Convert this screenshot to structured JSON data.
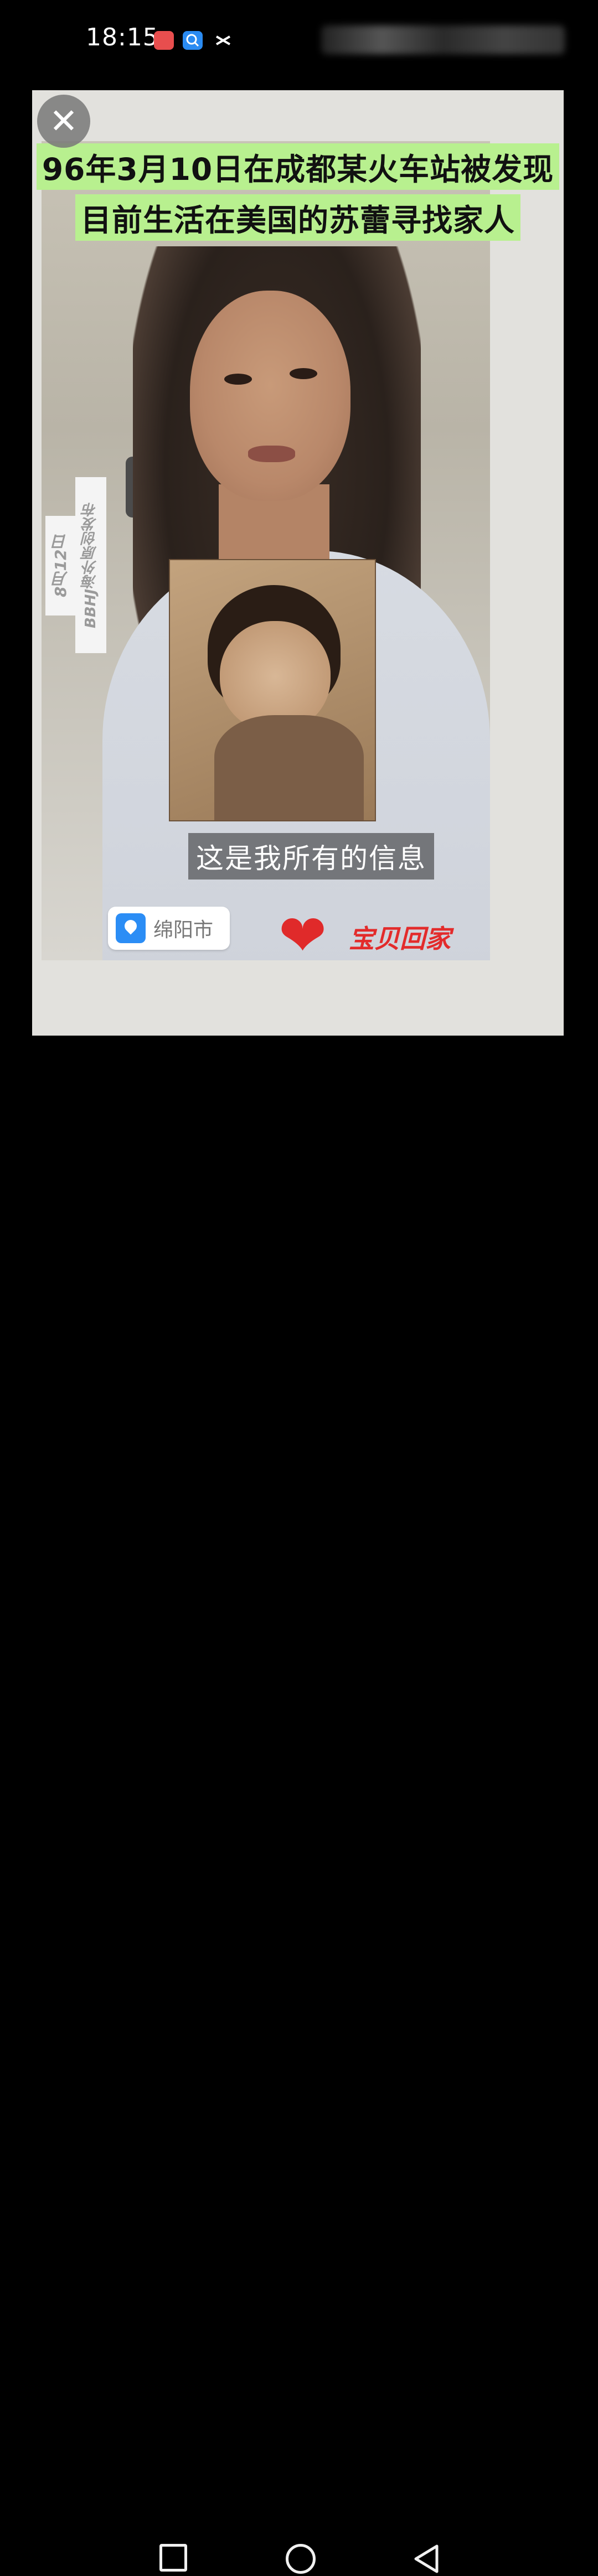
{
  "status_bar": {
    "time": "18:15",
    "icons": [
      "huawei-app-icon",
      "search-app-icon",
      "scissors-app-icon"
    ]
  },
  "viewer": {
    "close_icon": "✕",
    "headline_line1": "96年3月10日在成都某火车站被发现",
    "headline_line2": "目前生活在美国的苏蕾寻找家人",
    "side_tag_date": "8月12日",
    "side_tag_brand": "BBHJ海外原创发布",
    "subtitle": "这是我所有的信息",
    "location": "绵阳市",
    "logo_text": "宝贝回家"
  },
  "nav_bar": {
    "buttons": [
      "recents",
      "home",
      "back"
    ]
  }
}
